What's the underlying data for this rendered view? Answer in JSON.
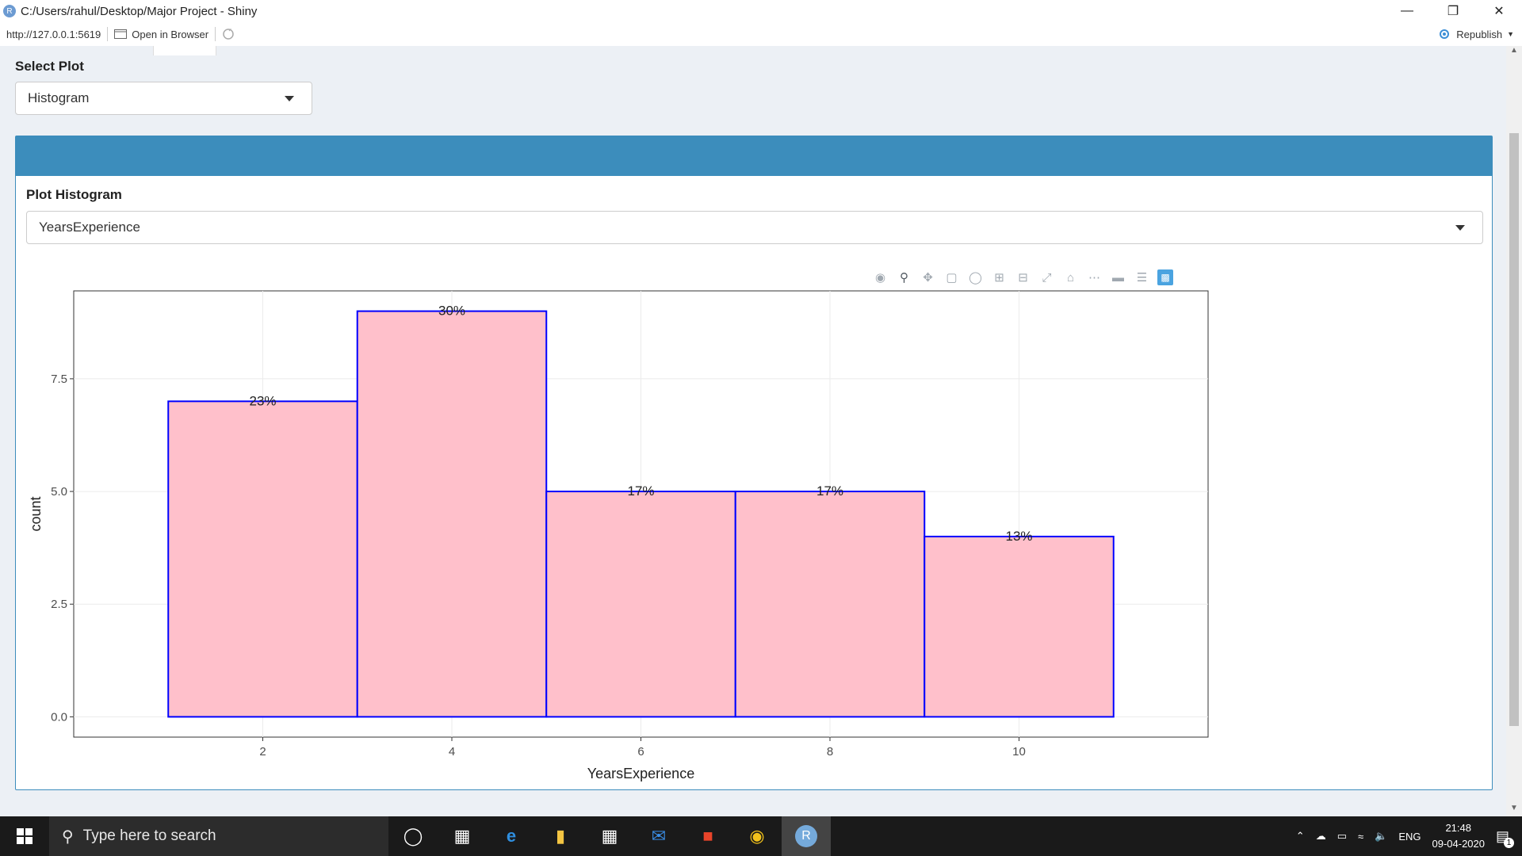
{
  "window": {
    "title": "C:/Users/rahul/Desktop/Major Project - Shiny",
    "app_icon_letter": "R",
    "minimize_glyph": "—",
    "restore_glyph": "❐",
    "close_glyph": "✕"
  },
  "viewer": {
    "url": "http://127.0.0.1:5619",
    "open_in_browser_label": "Open in Browser",
    "republish_label": "Republish"
  },
  "select_plot": {
    "label": "Select Plot",
    "value": "Histogram"
  },
  "plot_histogram": {
    "label": "Plot Histogram",
    "value": "YearsExperience"
  },
  "modebar": {
    "icons": [
      "camera-icon",
      "zoom-icon",
      "pan-icon",
      "box-select-icon",
      "lasso-select-icon",
      "zoom-in-icon",
      "zoom-out-icon",
      "autoscale-icon",
      "reset-axes-icon",
      "spike-lines-icon",
      "hover-closest-icon",
      "hover-compare-icon",
      "plotly-logo-icon"
    ]
  },
  "chart_data": {
    "type": "bar",
    "title": "",
    "xlabel": "YearsExperience",
    "ylabel": "count",
    "bins": [
      {
        "x0": 1,
        "x1": 3,
        "count": 7,
        "label": "23%"
      },
      {
        "x0": 3,
        "x1": 5,
        "count": 9,
        "label": "30%"
      },
      {
        "x0": 5,
        "x1": 7,
        "count": 5,
        "label": "17%"
      },
      {
        "x0": 7,
        "x1": 9,
        "count": 5,
        "label": "17%"
      },
      {
        "x0": 9,
        "x1": 11,
        "count": 4,
        "label": "13%"
      }
    ],
    "xlim": [
      0,
      12
    ],
    "ylim": [
      -0.45,
      9.45
    ],
    "xticks": [
      2,
      4,
      6,
      8,
      10
    ],
    "xtick_labels": [
      "2",
      "4",
      "6",
      "8",
      "10"
    ],
    "yticks": [
      0,
      2.5,
      5,
      7.5
    ],
    "ytick_labels": [
      "0.0",
      "2.5",
      "5.0",
      "7.5"
    ],
    "grid": true,
    "fill_color": "#ffc0cb",
    "edge_color": "#0000ff"
  },
  "taskbar": {
    "search_placeholder": "Type here to search",
    "language": "ENG",
    "time": "21:48",
    "date": "09-04-2020",
    "notification_count": "1"
  }
}
